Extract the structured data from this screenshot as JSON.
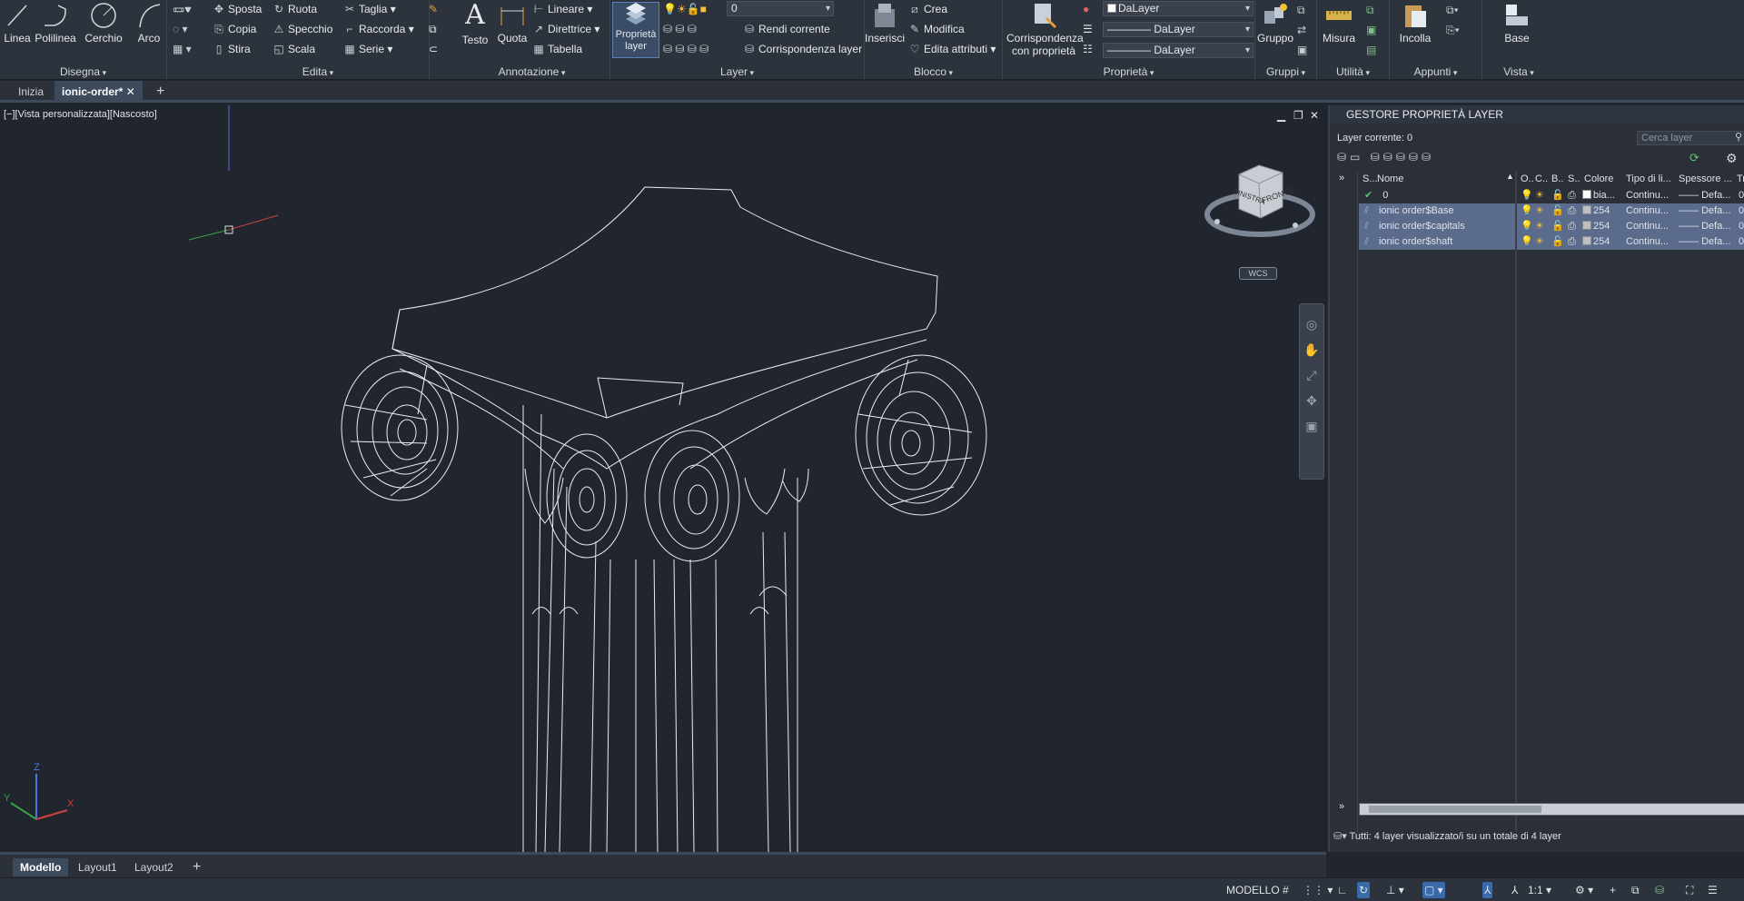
{
  "ribbon": {
    "disegna": {
      "title": "Disegna",
      "linea": "Linea",
      "polilinea": "Polilinea",
      "cerchio": "Cerchio",
      "arco": "Arco"
    },
    "edita": {
      "title": "Edita",
      "sposta": "Sposta",
      "ruota": "Ruota",
      "taglia": "Taglia",
      "copia": "Copia",
      "specchio": "Specchio",
      "raccorda": "Raccorda",
      "stira": "Stira",
      "scala": "Scala",
      "serie": "Serie"
    },
    "annotazione": {
      "title": "Annotazione",
      "testo": "Testo",
      "quota": "Quota",
      "lineare": "Lineare",
      "direttrice": "Direttrice",
      "tabella": "Tabella"
    },
    "layer": {
      "title": "Layer",
      "proprieta": "Proprietà layer",
      "current_layer": "0",
      "rendi_corrente": "Rendi corrente",
      "corrispondenza": "Corrispondenza layer"
    },
    "blocco": {
      "title": "Blocco",
      "inserisci": "Inserisci",
      "crea": "Crea",
      "modifica": "Modifica",
      "edita_attributi": "Edita attributi"
    },
    "proprieta": {
      "title": "Proprietà",
      "corrispondenza": "Corrispondenza con proprietà",
      "color": "DaLayer",
      "linetype": "DaLayer",
      "lineweight": "DaLayer"
    },
    "gruppi": {
      "title": "Gruppi",
      "gruppo": "Gruppo"
    },
    "utilita": {
      "title": "Utilità",
      "misura": "Misura"
    },
    "appunti": {
      "title": "Appunti",
      "incolla": "Incolla"
    },
    "vista": {
      "title": "Vista",
      "base": "Base"
    }
  },
  "tabs": {
    "inizia": "Inizia",
    "file": "ionic-order*"
  },
  "viewport": {
    "label": "[−][Vista personalizzata][Nascosto]",
    "viewcube": {
      "left": "SINISTRA",
      "front": "FRONTE"
    },
    "wcs": "WCS",
    "axis_x": "X",
    "axis_y": "Y",
    "axis_z": "Z"
  },
  "lpm": {
    "title": "GESTORE PROPRIETÀ LAYER",
    "current": "Layer corrente: 0",
    "search_placeholder": "Cerca layer",
    "headers": {
      "s": "S...",
      "nome": "Nome",
      "o": "O...",
      "c": "C...",
      "b": "B...",
      "s2": "S...",
      "colore": "Colore",
      "tipo": "Tipo di li...",
      "spessore": "Spessore ...",
      "tr": "Tr"
    },
    "layers": [
      {
        "name": "0",
        "color": "bia...",
        "linetype": "Continu...",
        "lineweight": "Defa...",
        "tr": "0",
        "selected": false,
        "current": true
      },
      {
        "name": "ionic order$Base",
        "color": "254",
        "linetype": "Continu...",
        "lineweight": "Defa...",
        "tr": "0",
        "selected": true,
        "current": false
      },
      {
        "name": "ionic order$capitals",
        "color": "254",
        "linetype": "Continu...",
        "lineweight": "Defa...",
        "tr": "0",
        "selected": true,
        "current": false
      },
      {
        "name": "ionic order$shaft",
        "color": "254",
        "linetype": "Continu...",
        "lineweight": "Defa...",
        "tr": "0",
        "selected": true,
        "current": false
      }
    ],
    "status": "Tutti: 4 layer visualizzato/i su un totale di 4 layer"
  },
  "layouts": {
    "modello": "Modello",
    "layout1": "Layout1",
    "layout2": "Layout2"
  },
  "statusbar": {
    "mode": "MODELLO",
    "scale": "1:1"
  }
}
